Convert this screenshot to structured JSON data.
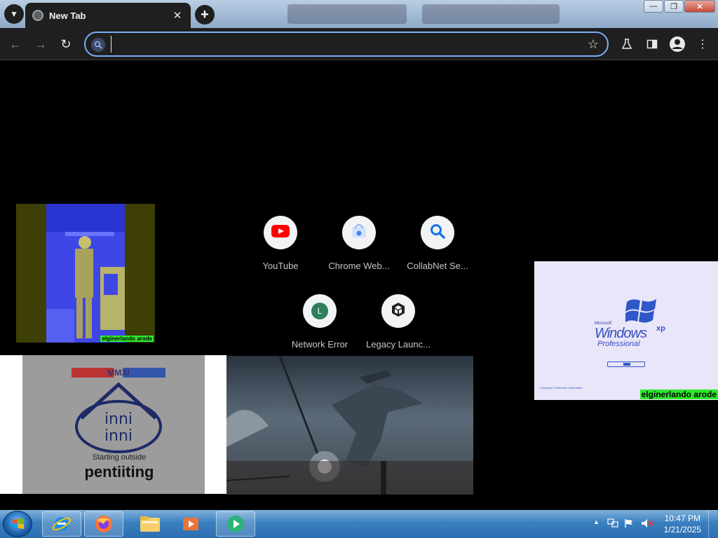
{
  "browser": {
    "tab": {
      "title": "New Tab"
    },
    "omnibox": {
      "value": "",
      "placeholder": ""
    }
  },
  "shortcuts": [
    {
      "label": "YouTube",
      "icon": "youtube-icon"
    },
    {
      "label": "Chrome Web...",
      "icon": "chrome-web-store-icon"
    },
    {
      "label": "CollabNet Se...",
      "icon": "search-icon"
    },
    {
      "label": "Network Error",
      "icon": "letter-l-icon",
      "letter": "L"
    },
    {
      "label": "Legacy Launc...",
      "icon": "legacy-launcher-icon"
    }
  ],
  "overlays": {
    "watermark_text": "elginerlando arode",
    "xp_splash": {
      "microsoft": "Microsoft",
      "windows": "Windows",
      "xp": "xp",
      "edition": "Professional",
      "copyright": "Copyright © Microsoft Corporation"
    },
    "emblem": {
      "top_text": "MMXI",
      "bottom_caption": "Starting outside",
      "bottom_word": "pentiiting"
    }
  },
  "taskbar": {
    "time": "10:47 PM",
    "date": "1/21/2025",
    "apps": [
      "internet-explorer-icon",
      "firefox-icon",
      "file-explorer-icon",
      "media-player-icon",
      "media-center-icon"
    ]
  },
  "colors": {
    "browser_dark": "#1f1f1f",
    "omnibox_focus": "#7cacf8",
    "youtube_red": "#ff0000",
    "watermark_green": "#2ee82e",
    "taskbar_blue": "#3a7fc0"
  }
}
